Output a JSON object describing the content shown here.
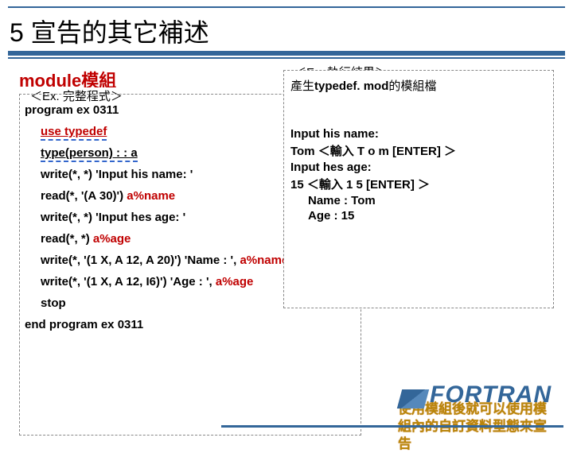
{
  "title": "5 宣告的其它補述",
  "heading": "module模組",
  "leftBox": {
    "label": "＜Ex. 完整程式＞",
    "lines": {
      "l1": "program ex 0311",
      "l2": "use typedef",
      "l3": "type(person) : : a",
      "l4": "write(*, *) 'Input his name: '",
      "l5_pre": "read(*, '(A 30)') ",
      "l5_red": "a%name",
      "l6": "write(*, *) 'Input hes age: '",
      "l7_pre": "read(*, *) ",
      "l7_red": "a%age",
      "l8_pre": "write(*, '(1 X, A 12, A 20)') 'Name : ', ",
      "l8_red": "a%name",
      "l9_pre": "write(*, '(1 X, A 12, I6)') 'Age : ', ",
      "l9_red": "a%age",
      "l10": "stop",
      "l11": "end program ex 0311"
    }
  },
  "rightBox": {
    "label": "＜Ex. 執行結果＞",
    "desc_pre": "產生",
    "desc_bold": "typedef. mod",
    "desc_post": "的模組檔",
    "r1": "Input his name:",
    "r2": "Tom ＜輸入 T o m [ENTER] ＞",
    "r3": "Input hes age:",
    "r4": "15 ＜輸入 1 5 [ENTER] ＞",
    "r5": "Name : Tom",
    "r6": "Age :    15"
  },
  "callout": "使用模組後就可以使用模組內的自訂資料型態來宣告",
  "logo": "FORTRAN"
}
